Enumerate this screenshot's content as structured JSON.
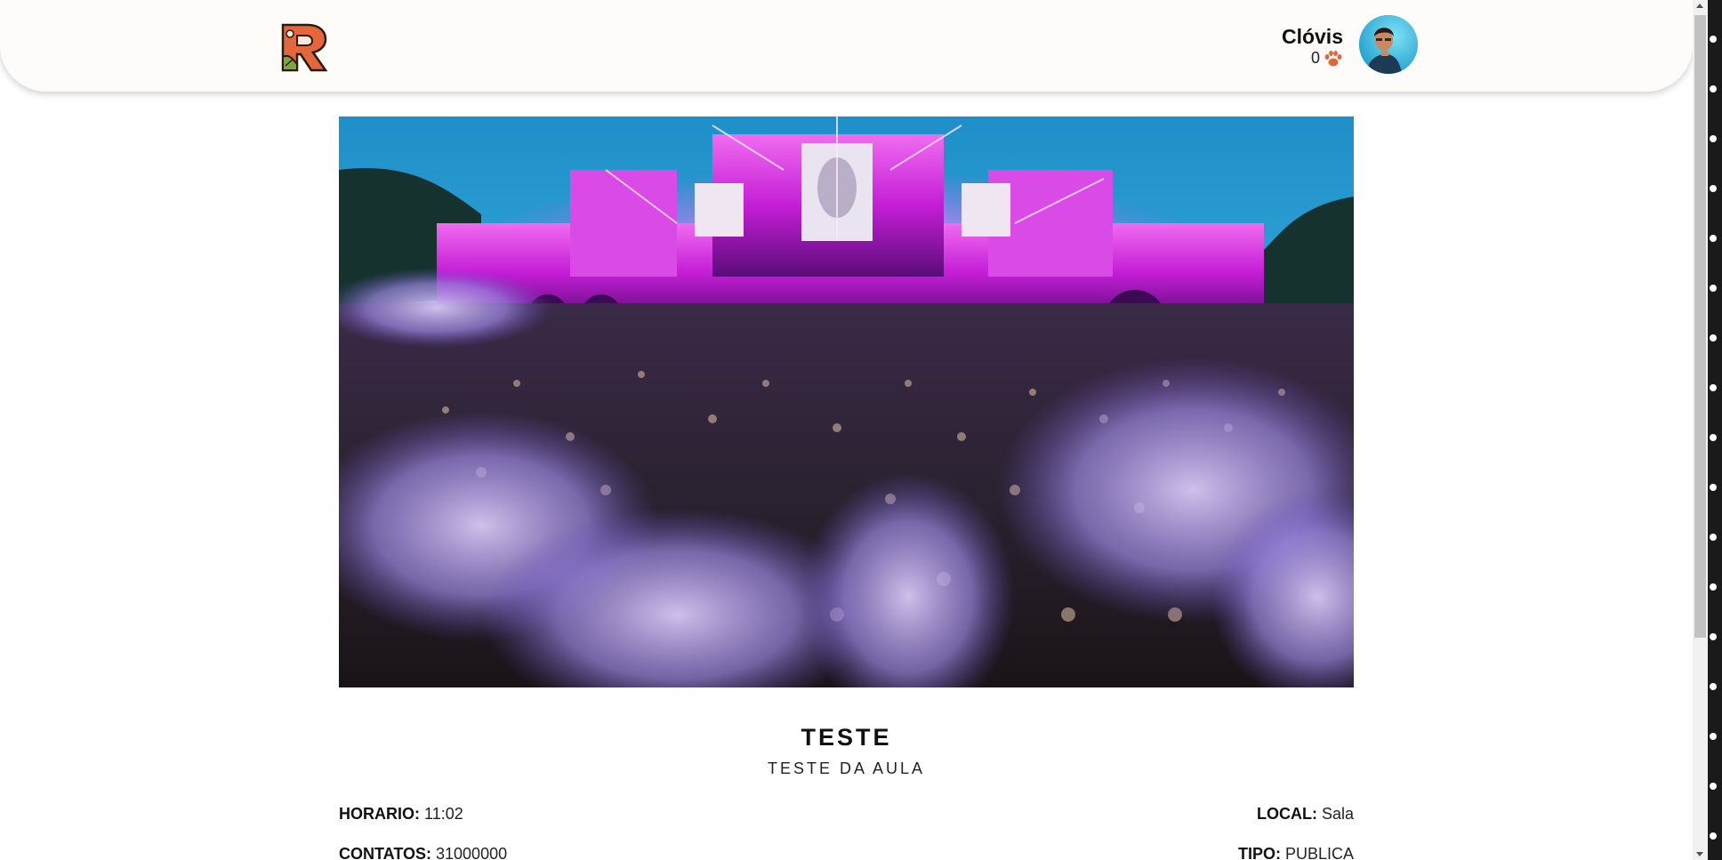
{
  "header": {
    "logo_letter": "R",
    "user": {
      "name": "Clóvis",
      "count": "0",
      "count_icon": "paw-icon",
      "avatar_icon": "user-avatar"
    }
  },
  "event": {
    "image_icon": "festival-crowd-photo",
    "title": "TESTE",
    "subtitle": "TESTE DA AULA",
    "fields": {
      "horario": {
        "label": "HORARIO:",
        "value": "11:02"
      },
      "local": {
        "label": "LOCAL:",
        "value": "Sala"
      },
      "contatos": {
        "label": "CONTATOS:",
        "value": "31000000"
      },
      "tipo": {
        "label": "TIPO:",
        "value": "PUBLICA"
      }
    }
  },
  "colors": {
    "header_bg": "#fdfcf8",
    "logo_orange": "#e2673d",
    "paw": "#e0663c",
    "stage_magenta": "#d92be0",
    "sky": "#2aa8d8"
  }
}
